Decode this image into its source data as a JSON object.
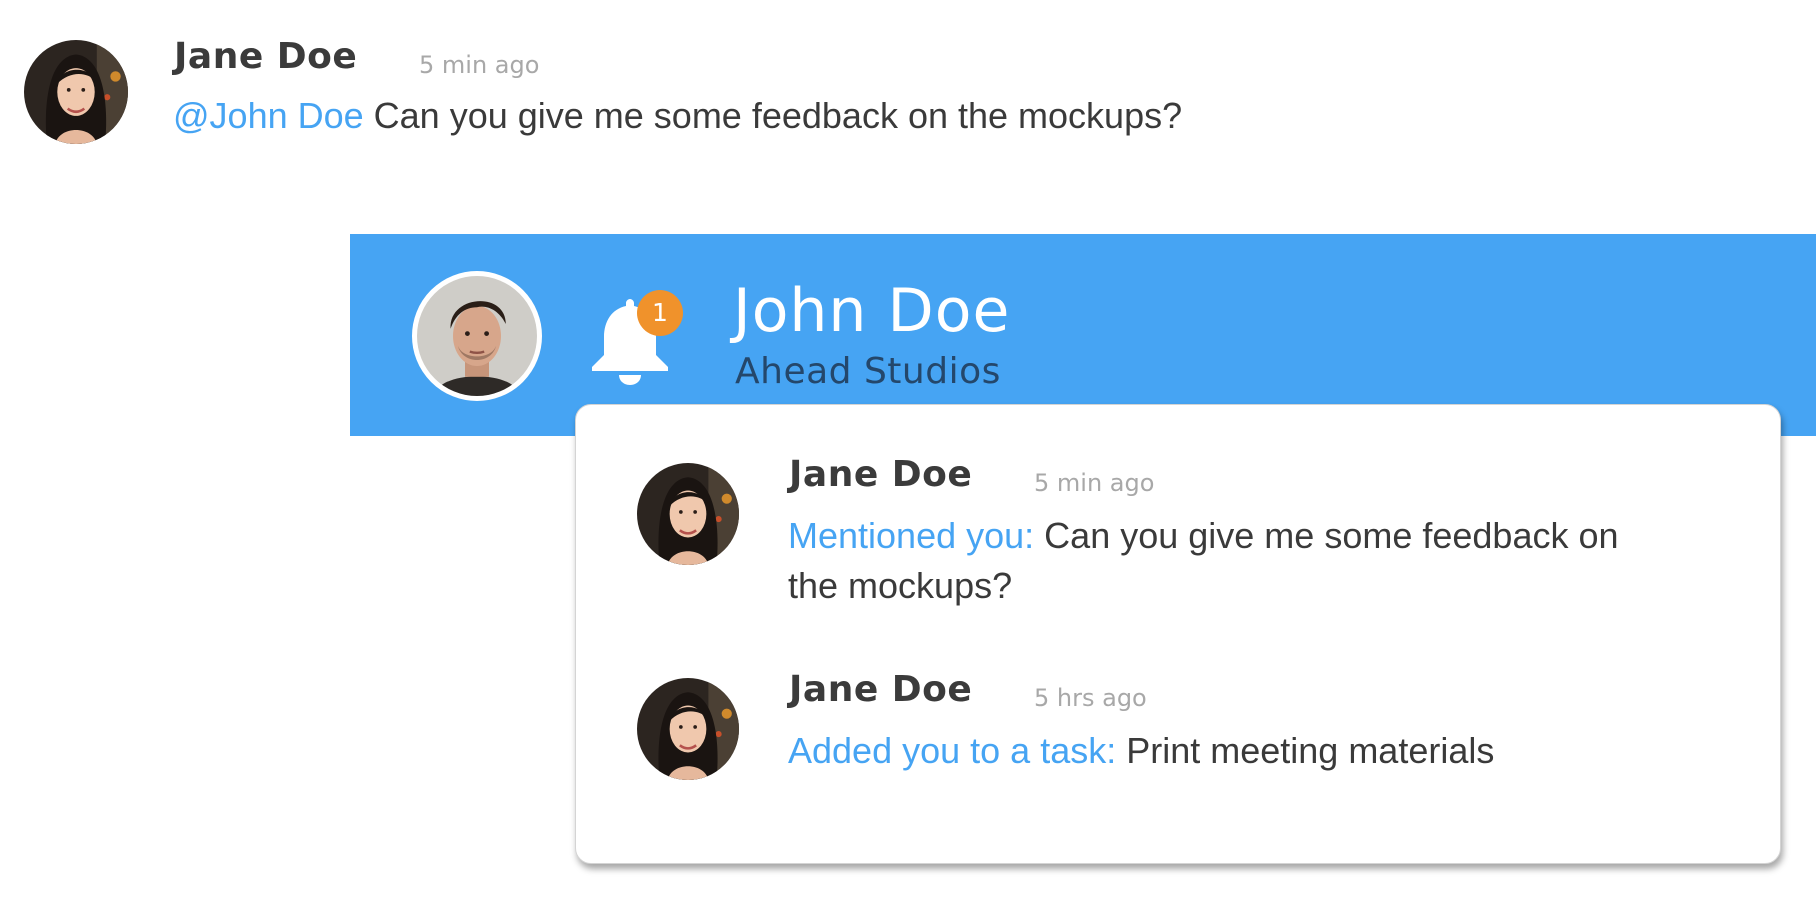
{
  "colors": {
    "accent": "#46a4f3",
    "header_background": "#46a4f3",
    "badge": "#f0922b",
    "company_text": "#24476b",
    "timestamp": "#a8a8a8"
  },
  "chat_message": {
    "author": "Jane Doe",
    "time": "5 min ago",
    "mention": "@John Doe",
    "text": " Can you give me some feedback on the mockups?",
    "avatar": "jane-avatar"
  },
  "header": {
    "user_name": "John Doe",
    "company": "Ahead Studios",
    "avatar": "john-avatar",
    "notification_icon": "bell-icon",
    "notification_count": "1"
  },
  "notifications": [
    {
      "author": "Jane Doe",
      "time": "5 min ago",
      "action": "Mentioned you:",
      "text": " Can you give me some feedback on the mockups?",
      "avatar": "jane-avatar"
    },
    {
      "author": "Jane Doe",
      "time": "5 hrs ago",
      "action": "Added you to a task:",
      "text": " Print meeting materials",
      "avatar": "jane-avatar"
    }
  ]
}
